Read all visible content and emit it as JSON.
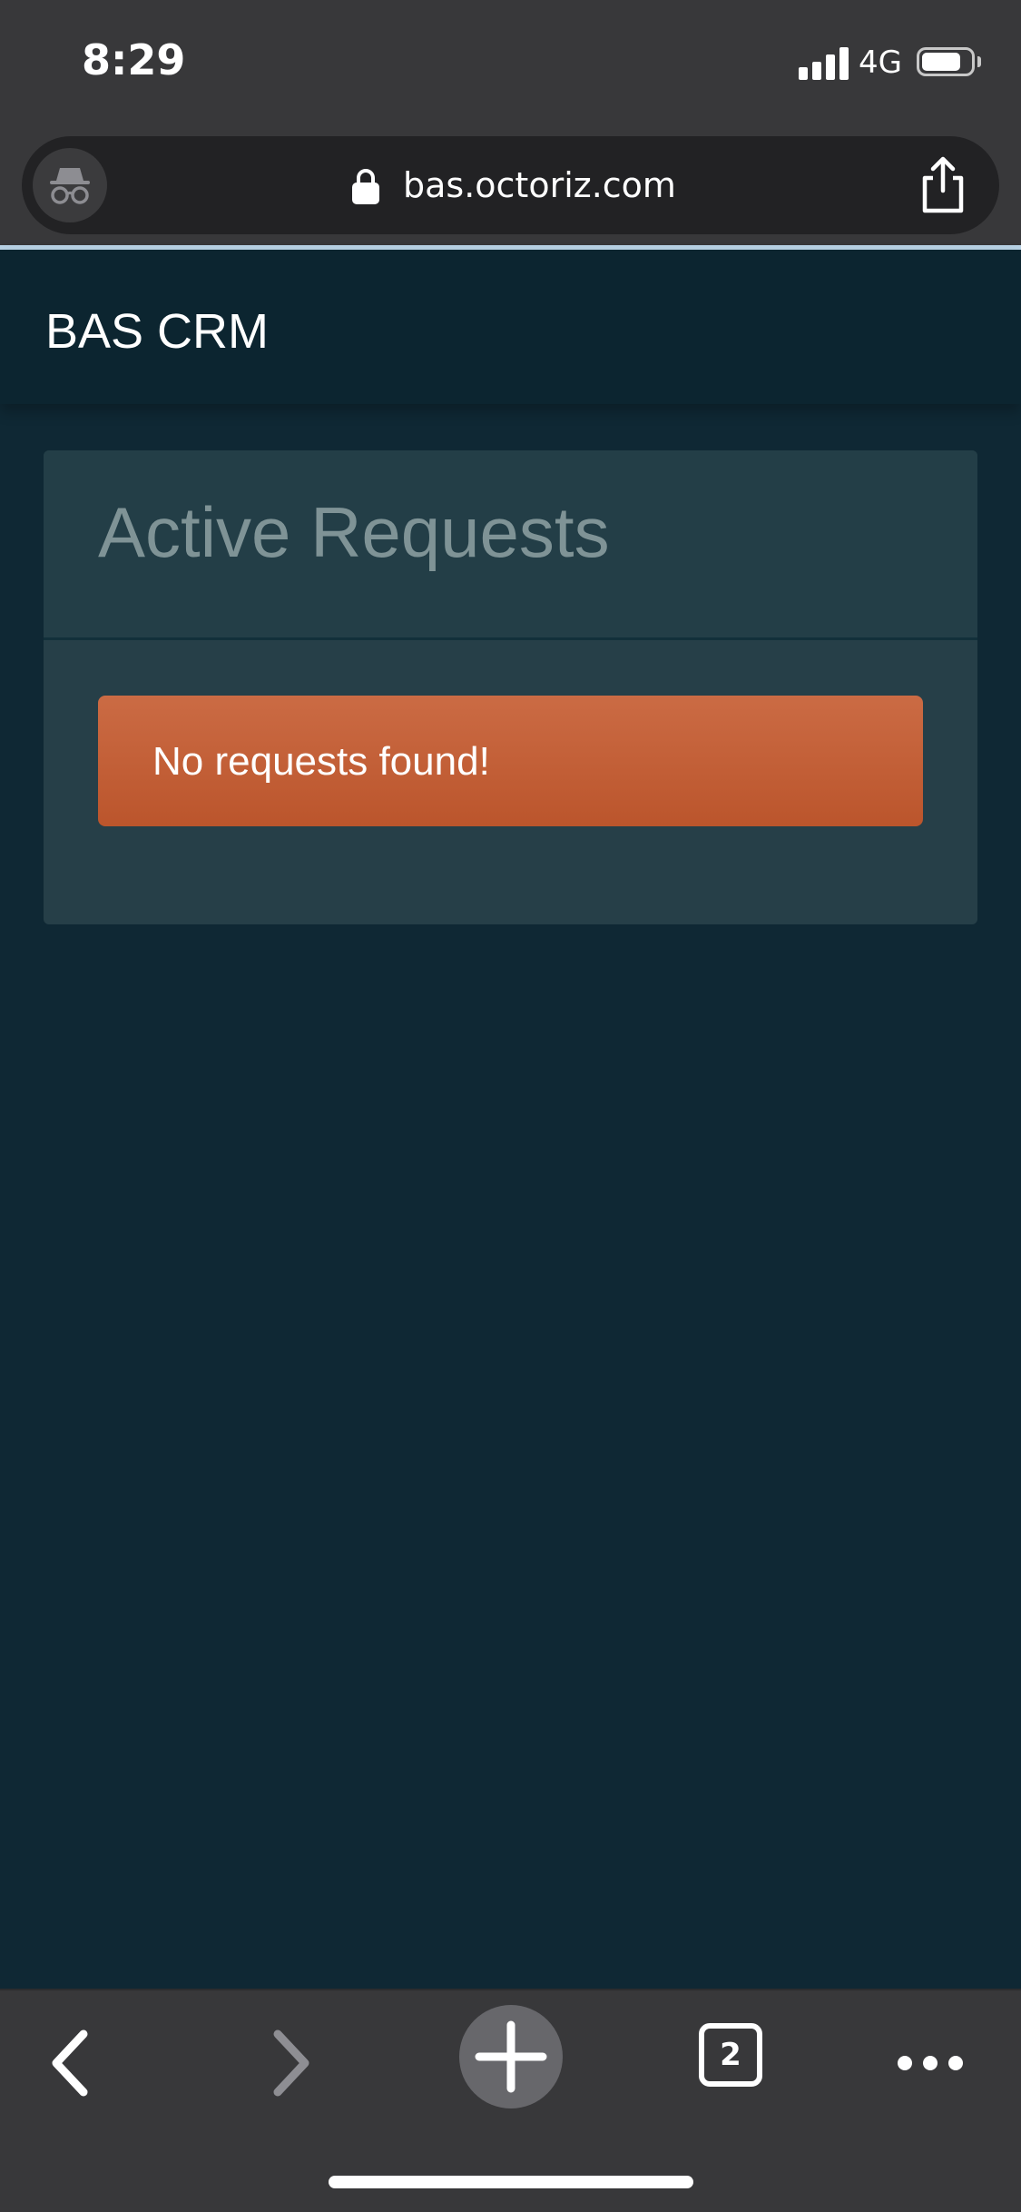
{
  "status_bar": {
    "time": "8:29",
    "network": "4G",
    "signal_bars": 4,
    "battery_level": 0.8
  },
  "browser": {
    "url": "bas.octoriz.com",
    "open_tabs": "2",
    "incognito": true,
    "icons": [
      "incognito-icon",
      "lock-icon",
      "share-icon",
      "back-icon",
      "forward-icon",
      "new-tab-icon",
      "tab-switcher-icon",
      "more-icon"
    ]
  },
  "page": {
    "brand": "BAS CRM",
    "card_title": "Active Requests",
    "alert_message": "No requests found!"
  },
  "colors": {
    "page_background": "#0f2834",
    "navbar_background": "#0c2530",
    "card_background": "#263f48",
    "alert_background": "#c45f36",
    "browser_chrome": "#38383a"
  }
}
